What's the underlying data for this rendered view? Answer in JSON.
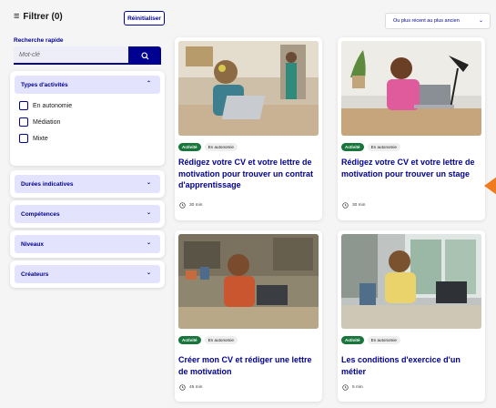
{
  "filters": {
    "title": "Filtrer (0)",
    "reset_label": "Réinitialiser",
    "quick_search": {
      "label": "Recherche rapide",
      "placeholder": "Mot-clé"
    },
    "activity_types": {
      "label": "Types d'activités",
      "options": [
        "En autonomie",
        "Médiation",
        "Mixte"
      ]
    },
    "accordions": [
      "Durées indicatives",
      "Compétences",
      "Niveaux",
      "Créateurs"
    ]
  },
  "sort": {
    "value": "Ou plus récent au plus ancien"
  },
  "cards": [
    {
      "badges": [
        "Activité",
        "En autonomie"
      ],
      "title": "Rédigez votre CV et votre lettre de motivation pour trouver un contrat d'apprentissage",
      "duration": "30 min"
    },
    {
      "badges": [
        "Activité",
        "En autonomie"
      ],
      "title": "Rédigez votre CV et votre lettre de motivation pour trouver un stage",
      "duration": "30 min"
    },
    {
      "badges": [
        "Activité",
        "En autonomie"
      ],
      "title": "Créer mon CV et rédiger une lettre de motivation",
      "duration": "45 min"
    },
    {
      "badges": [
        "Activité",
        "En autonomie"
      ],
      "title": "Les conditions d'exercice d'un métier",
      "duration": "5 min"
    }
  ],
  "colors": {
    "primary": "#000091",
    "badge_green": "#18753c",
    "accent_orange": "#f07b1f"
  }
}
